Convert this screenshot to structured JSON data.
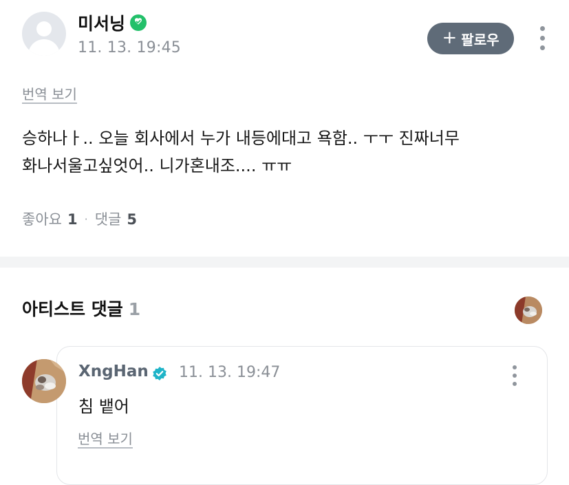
{
  "post": {
    "author": "미서닝",
    "time": "11. 13. 19:45",
    "follow_label": "팔로우",
    "translate_label": "번역 보기",
    "body_lines": [
      "승하나ㅏ.. 오늘 회사에서 누가 내등에대고 욕함.. ㅜㅜ 진짜너무",
      "화나서울고싶엇어.. 니가혼내조.... ㅠㅠ"
    ],
    "likes_label": "좋아요",
    "likes_count": "1",
    "comments_label": "댓글",
    "comments_count": "5",
    "separator": "·"
  },
  "artist_section": {
    "title": "아티스트 댓글",
    "count": "1"
  },
  "comment": {
    "author": "XngHan",
    "time": "11. 13. 19:47",
    "text": "침 뱉어",
    "translate_label": "번역 보기"
  },
  "colors": {
    "follow_button": "#5f6b78",
    "verified_author": "#23c06a",
    "verified_artist": "#1fb4c8",
    "muted_text": "#8a8f96",
    "section_band": "#f3f4f5"
  },
  "icons": [
    "default-avatar-icon",
    "verified-badge-icon",
    "plus-icon",
    "more-vertical-icon",
    "artist-verified-icon"
  ]
}
